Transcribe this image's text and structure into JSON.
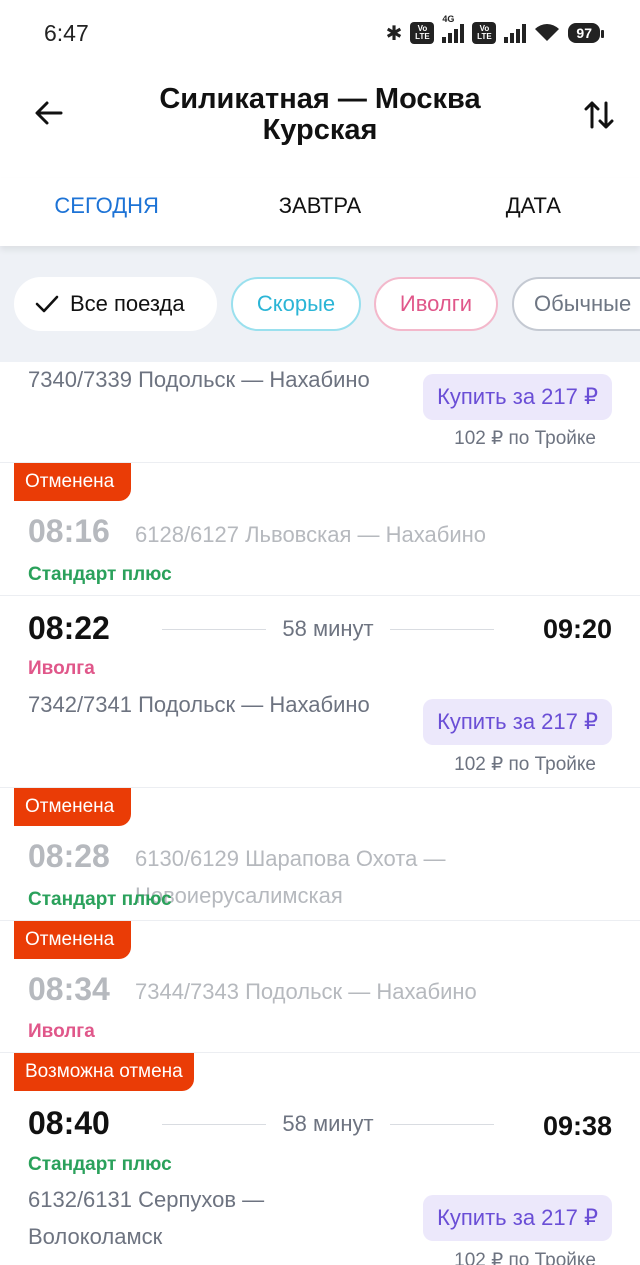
{
  "status_bar": {
    "time": "6:47",
    "network": "4G",
    "volte_1": "Vo LTE",
    "volte_2": "Vo LTE",
    "battery": "97",
    "icons": [
      "bluetooth-icon",
      "volte-icon",
      "signal-icon",
      "volte-icon",
      "signal-icon",
      "wifi-icon",
      "battery-icon"
    ]
  },
  "header": {
    "title": "Силикатная — Москва Курская",
    "back_icon": "arrow-left-icon",
    "swap_icon": "swap-vertical-icon"
  },
  "date_tabs": [
    {
      "label": "СЕГОДНЯ",
      "active": true
    },
    {
      "label": "ЗАВТРА",
      "active": false
    },
    {
      "label": "ДАТА",
      "active": false
    }
  ],
  "filters": [
    {
      "label": "Все поезда",
      "selected": true,
      "icon": "checkmark-icon"
    },
    {
      "label": "Скорые",
      "selected": false
    },
    {
      "label": "Иволги",
      "selected": false
    },
    {
      "label": "Обычные",
      "selected": false
    }
  ],
  "trains": [
    {
      "partial": true,
      "route": "7340/7339 Подольск — Нахабино",
      "buy_label": "Купить за 217 ₽",
      "troika": "102 ₽ по Тройке"
    },
    {
      "badge": "Отменена",
      "departure": "08:16",
      "route": "6128/6127 Львовская — Нахабино",
      "type": "Стандарт плюс"
    },
    {
      "departure": "08:22",
      "duration": "58 минут",
      "arrival": "09:20",
      "type": "Иволга",
      "route": "7342/7341 Подольск — Нахабино",
      "buy_label": "Купить за 217 ₽",
      "troika": "102 ₽ по Тройке"
    },
    {
      "badge": "Отменена",
      "departure": "08:28",
      "route_line1": "6130/6129 Шарапова Охота —",
      "route_line2": "Новоиерусалимская",
      "type": "Стандарт плюс"
    },
    {
      "badge": "Отменена",
      "departure": "08:34",
      "route": "7344/7343 Подольск — Нахабино",
      "type": "Иволга"
    },
    {
      "badge": "Возможна отмена",
      "departure": "08:40",
      "duration": "58 минут",
      "arrival": "09:38",
      "type": "Стандарт плюс",
      "route_line1": "6132/6131 Серпухов —",
      "route_line2": "Волоколамск",
      "buy_label": "Купить за 217 ₽",
      "troika": "102 ₽ по Тройке"
    }
  ],
  "colors": {
    "accent_blue": "#1d73d6",
    "cancel_red": "#ea3c06",
    "standard_green": "#2aa15b",
    "ivolga_pink": "#e0578a",
    "buy_purple": "#6a4ed6",
    "buy_bg": "#ece8fb",
    "filter_bg": "#eef1f6"
  }
}
